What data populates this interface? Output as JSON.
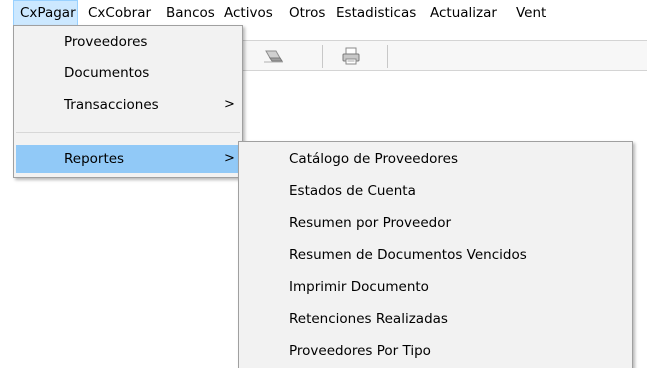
{
  "menubar": {
    "items": [
      {
        "label": "CxPagar",
        "active": true
      },
      {
        "label": "CxCobrar"
      },
      {
        "label": "Bancos"
      },
      {
        "label": "Activos"
      },
      {
        "label": "Otros"
      },
      {
        "label": "Estadisticas"
      },
      {
        "label": "Actualizar"
      },
      {
        "label": "Vent"
      }
    ]
  },
  "toolbar": {
    "buttons": [
      {
        "icon": "eraser-icon"
      },
      {
        "icon": "printer-icon"
      }
    ]
  },
  "cxpagar_menu": {
    "items": [
      {
        "label": "Proveedores"
      },
      {
        "label": "Documentos"
      },
      {
        "label": "Transacciones",
        "submenu": true
      },
      {
        "label": "Reportes",
        "submenu": true,
        "highlighted": true
      }
    ],
    "submenu_arrow": ">"
  },
  "reportes_submenu": {
    "items": [
      {
        "label": "Catálogo de Proveedores"
      },
      {
        "label": "Estados de Cuenta"
      },
      {
        "label": "Resumen por Proveedor"
      },
      {
        "label": "Resumen de Documentos Vencidos"
      },
      {
        "label": "Imprimir Documento"
      },
      {
        "label": "Retenciones Realizadas"
      },
      {
        "label": "Proveedores Por Tipo"
      }
    ]
  },
  "colors": {
    "menubar_active_bg": "#cce8ff",
    "menu_highlight_bg": "#91c9f7",
    "menu_bg": "#f2f2f2"
  }
}
